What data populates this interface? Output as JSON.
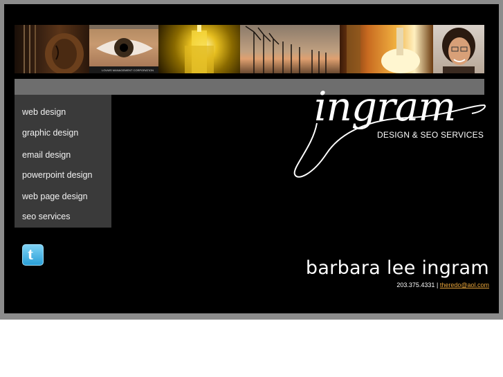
{
  "banner": {
    "logo_caption": "LOUWS MANAGEMENT CORPORATION"
  },
  "menu": {
    "items": [
      {
        "label": "web design"
      },
      {
        "label": "graphic design"
      },
      {
        "label": "email design"
      },
      {
        "label": "powerpoint design"
      },
      {
        "label": "web page design"
      },
      {
        "label": "seo services"
      }
    ]
  },
  "brand": {
    "logo_text": "ingram",
    "tagline": "DESIGN & SEO SERVICES"
  },
  "contact": {
    "name": "barbara lee ingram",
    "phone": "203.375.4331",
    "separator": "|",
    "email": "theredo@aol.com"
  },
  "social": {
    "twitter_letter": "t"
  },
  "colors": {
    "frame": "#8c8c8c",
    "stage": "#000000",
    "menu_bg": "#3a3a3a",
    "grey_bar": "#6e6e6e",
    "email_link": "#e8a43a"
  }
}
